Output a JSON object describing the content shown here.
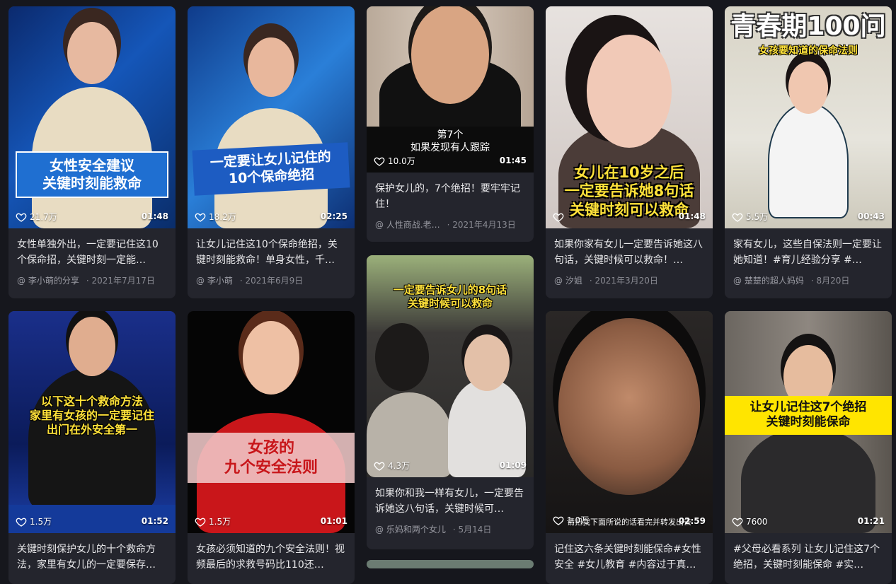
{
  "cards": [
    {
      "overlay": "女性安全建议\n关键时刻能救命",
      "likes": "21.7万",
      "duration": "01:48",
      "description": "女性单独外出，一定要记住这10个保命招，关键时刻一定能…",
      "author": "@ 李小萌的分享",
      "date": "2021年7月17日"
    },
    {
      "overlay": "一定要让女儿记住的\n10个保命绝招",
      "likes": "18.2万",
      "duration": "02:25",
      "description": "让女儿记住这10个保命绝招，关键时刻能救命！单身女性，千…",
      "author": "@ 李小萌",
      "date": "2021年6月9日"
    },
    {
      "overlay": "第7个\n如果发现有人跟踪",
      "likes": "10.0万",
      "duration": "01:45",
      "description": "保护女儿的，7个绝招！要牢牢记住！",
      "author": "@ 人性商战.老…",
      "date": "2021年4月13日"
    },
    {
      "overlay": "女儿在10岁之后\n一定要告诉她8句话\n关键时刻可以救命",
      "likes": "",
      "duration": "01:48",
      "description": "如果你家有女儿一定要告诉她这八句话，关键时候可以救命！…",
      "author": "@ 汐姐",
      "date": "2021年3月20日"
    },
    {
      "overlay_title": "青春期100问",
      "overlay": "女孩要知道的保命法则",
      "likes": "5.5万",
      "duration": "00:43",
      "description": "家有女儿，这些自保法则一定要让她知道！#育儿经验分享 #…",
      "author": "@ 楚楚的超人妈妈",
      "date": "8月20日"
    },
    {
      "overlay": "以下这十个救命方法\n家里有女孩的一定要记住\n出门在外安全第一",
      "likes": "1.5万",
      "duration": "01:52",
      "description": "关键时刻保护女儿的十个救命方法，家里有女儿的一定要保存…",
      "author": "",
      "date": ""
    },
    {
      "overlay": "女孩的\n九个安全法则",
      "likes": "1.5万",
      "duration": "01:01",
      "description": "女孩必须知道的九个安全法则！视频最后的求救号码比110还…",
      "author": "",
      "date": ""
    },
    {
      "overlay": "一定要告诉女儿的8句话\n关键时候可以救命",
      "likes": "4.3万",
      "duration": "01:09",
      "description": "如果你和我一样有女儿，一定要告诉她这八句话，关键时候可…",
      "author": "@ 乐妈和两个女儿",
      "date": "5月14日"
    },
    {
      "overlay": "请把我下面所说的话看完并转发出去",
      "likes": "1.0万",
      "duration": "02:59",
      "description": "记住这六条关键时刻能保命#女性安全 #女儿教育 #内容过于真…",
      "author": "",
      "date": ""
    },
    {
      "overlay": "让女儿记住这7个绝招\n关键时刻能保命",
      "likes": "7600",
      "duration": "01:21",
      "description": "#父母必看系列 让女儿记住这7个绝招，关键时刻能保命 #实…",
      "author": "",
      "date": ""
    }
  ]
}
